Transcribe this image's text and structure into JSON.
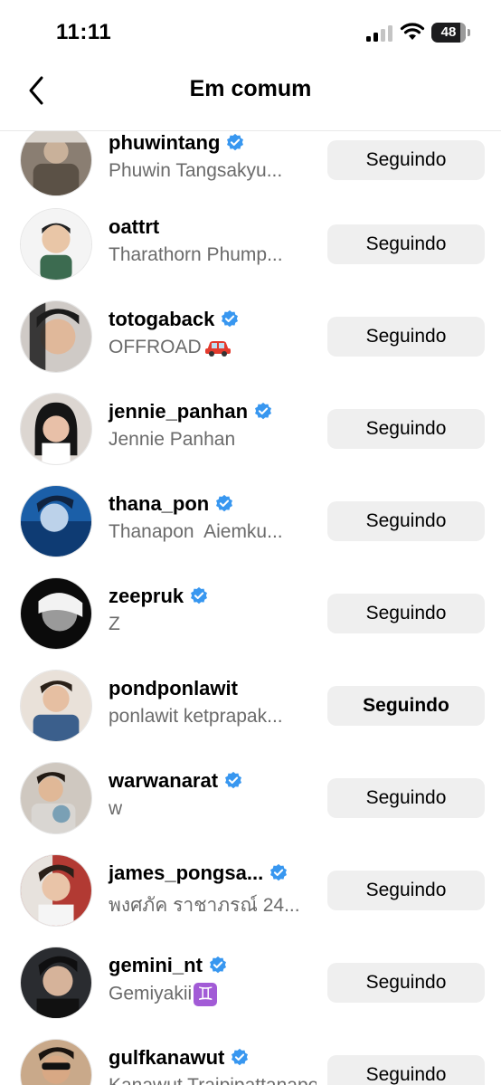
{
  "status_bar": {
    "time": "11:11",
    "battery": "48"
  },
  "header": {
    "title": "Em comum"
  },
  "users": [
    {
      "username": "phuwintang",
      "fullname": "Phuwin Tangsakyu...",
      "verified": true,
      "button": "Seguindo"
    },
    {
      "username": "oattrt",
      "fullname": "Tharathorn Phump...",
      "verified": false,
      "button": "Seguindo"
    },
    {
      "username": "totogaback",
      "fullname": "OFFROAD",
      "verified": true,
      "button": "Seguindo",
      "emoji": "car-emoji"
    },
    {
      "username": "jennie_panhan",
      "fullname": "Jennie Panhan",
      "verified": true,
      "button": "Seguindo"
    },
    {
      "username": "thana_pon",
      "fullname": "Thanapon  Aiemku...",
      "verified": true,
      "button": "Seguindo"
    },
    {
      "username": "zeepruk",
      "fullname": "Z",
      "verified": true,
      "button": "Seguindo"
    },
    {
      "username": "pondponlawit",
      "fullname": "ponlawit ketprapak...",
      "verified": false,
      "button": "Seguindo"
    },
    {
      "username": "warwanarat",
      "fullname": "w",
      "verified": true,
      "button": "Seguindo"
    },
    {
      "username": "james_pongsa...",
      "fullname": "พงศภัค ราชาภรณ์ 24...",
      "verified": true,
      "button": "Seguindo"
    },
    {
      "username": "gemini_nt",
      "fullname": "Gemiyakii",
      "verified": true,
      "button": "Seguindo",
      "emoji": "gemini-emoji",
      "emoji_text": "♊"
    },
    {
      "username": "gulfkanawut",
      "fullname": "Kanawut Traipipattanapong",
      "verified": true,
      "button": "Seguindo"
    }
  ],
  "colors": {
    "verified_blue": "#3897f0",
    "button_bg": "#efefef",
    "secondary_text": "#6b6b6b"
  }
}
